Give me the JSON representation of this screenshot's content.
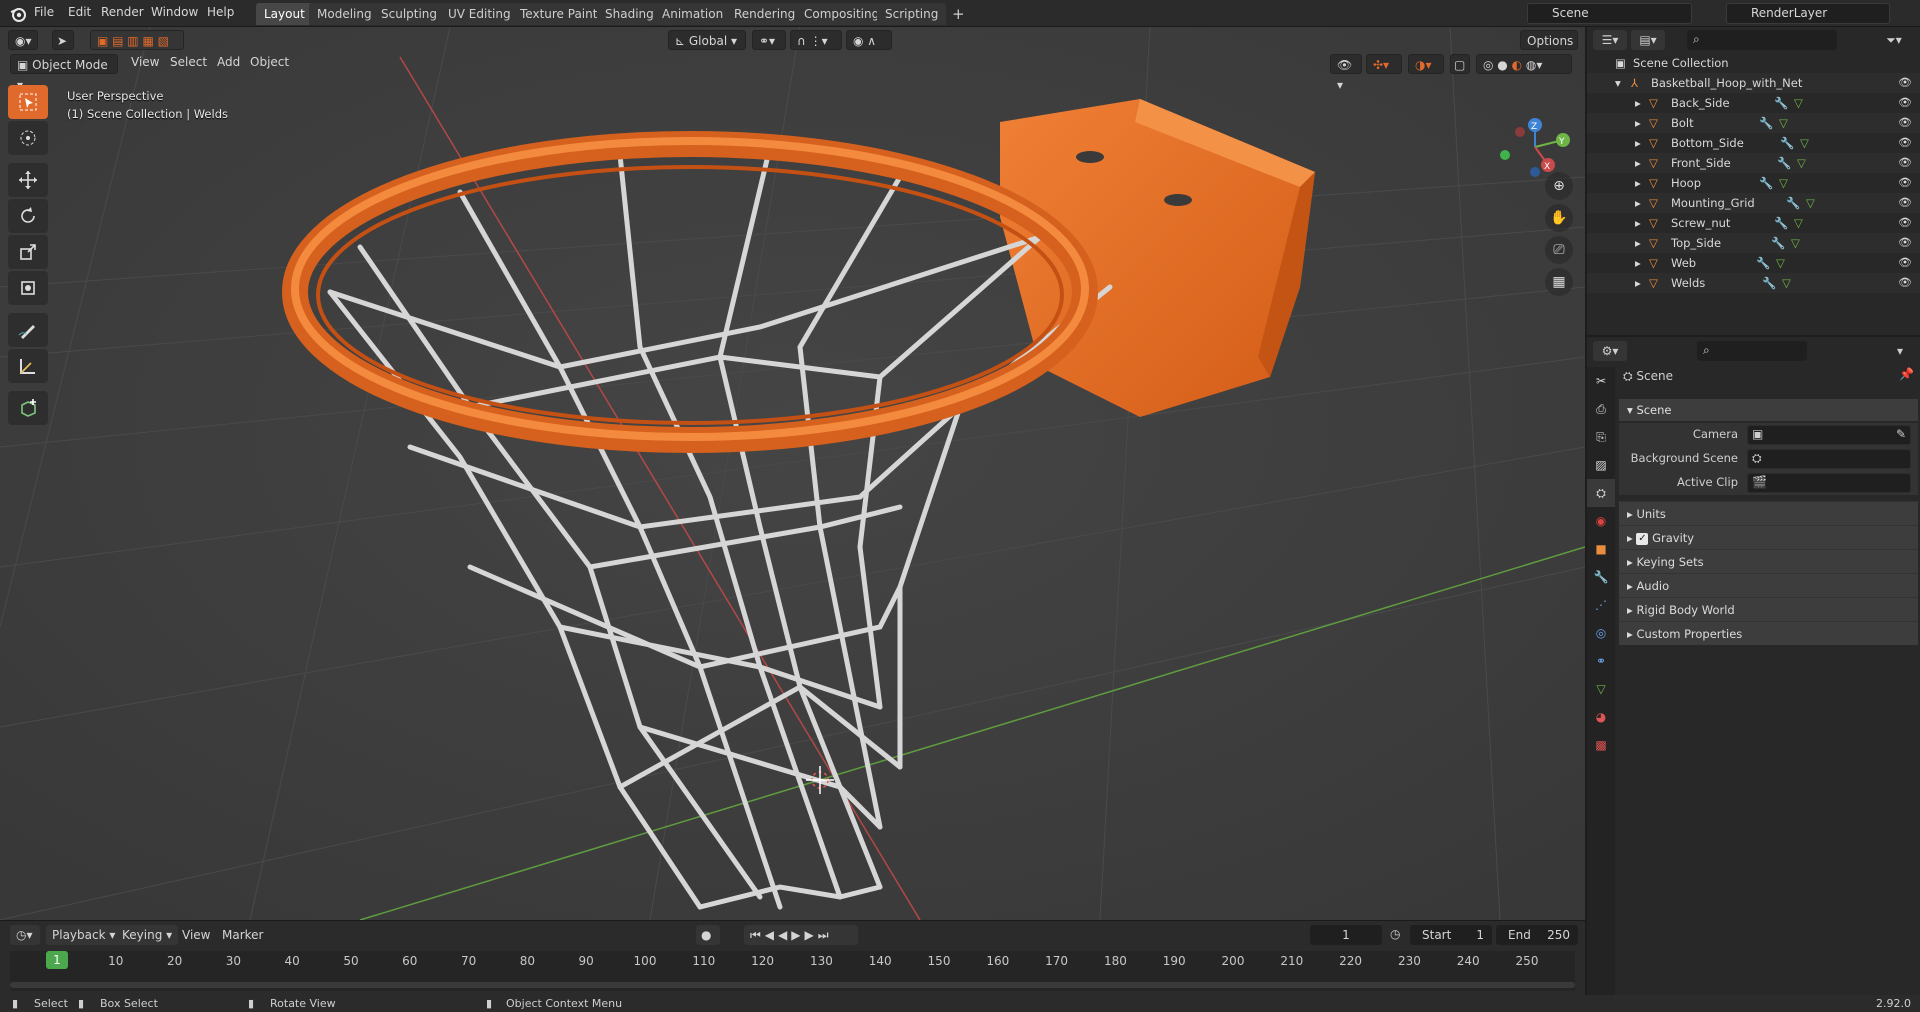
{
  "colors": {
    "accent": "#e06a2b",
    "active_frame": "#4ca84c",
    "hoop_orange": "#e86a1e",
    "net_white": "#d8d8d8",
    "x_axis": "#c94a4a",
    "y_axis": "#6fb447",
    "z_axis": "#3f83d6"
  },
  "topbar": {
    "menu": [
      "File",
      "Edit",
      "Render",
      "Window",
      "Help"
    ],
    "workspaces": [
      "Layout",
      "Modeling",
      "Sculpting",
      "UV Editing",
      "Texture Paint",
      "Shading",
      "Animation",
      "Rendering",
      "Compositing",
      "Scripting"
    ],
    "active_workspace": "Layout",
    "add_tab": "+",
    "scene": "Scene",
    "view_layer": "RenderLayer"
  },
  "viewport": {
    "mode": "Object Mode",
    "menus": [
      "View",
      "Select",
      "Add",
      "Object"
    ],
    "transform_orientation": "Global",
    "options": "Options",
    "overlay_line1": "User Perspective",
    "overlay_line2": "(1) Scene Collection | Welds",
    "gizmo_labels": {
      "z": "Z",
      "y": "Y",
      "x": "X"
    }
  },
  "outliner": {
    "root": "Scene Collection",
    "collection": "Basketball_Hoop_with_Net",
    "objects": [
      "Back_Side",
      "Bolt",
      "Bottom_Side",
      "Front_Side",
      "Hoop",
      "Mounting_Grid",
      "Screw_nut",
      "Top_Side",
      "Web",
      "Welds"
    ]
  },
  "properties": {
    "breadcrumb": "Scene",
    "panel_title": "Scene",
    "fields": [
      {
        "label": "Camera"
      },
      {
        "label": "Background Scene"
      },
      {
        "label": "Active Clip"
      }
    ],
    "subpanels": [
      "Units",
      "Gravity",
      "Keying Sets",
      "Audio",
      "Rigid Body World",
      "Custom Properties"
    ],
    "gravity_checked": true
  },
  "timeline": {
    "menus": [
      "Playback",
      "Keying",
      "View",
      "Marker"
    ],
    "current_frame": "1",
    "start_label": "Start",
    "start": "1",
    "end_label": "End",
    "end": "250",
    "ticks": [
      "10",
      "20",
      "30",
      "40",
      "50",
      "60",
      "70",
      "80",
      "90",
      "100",
      "110",
      "120",
      "130",
      "140",
      "150",
      "160",
      "170",
      "180",
      "190",
      "200",
      "210",
      "220",
      "230",
      "240",
      "250"
    ],
    "cursor_label": "1"
  },
  "statusbar": {
    "select": "Select",
    "box_select": "Box Select",
    "rotate": "Rotate View",
    "context": "Object Context Menu",
    "version": "2.92.0"
  }
}
